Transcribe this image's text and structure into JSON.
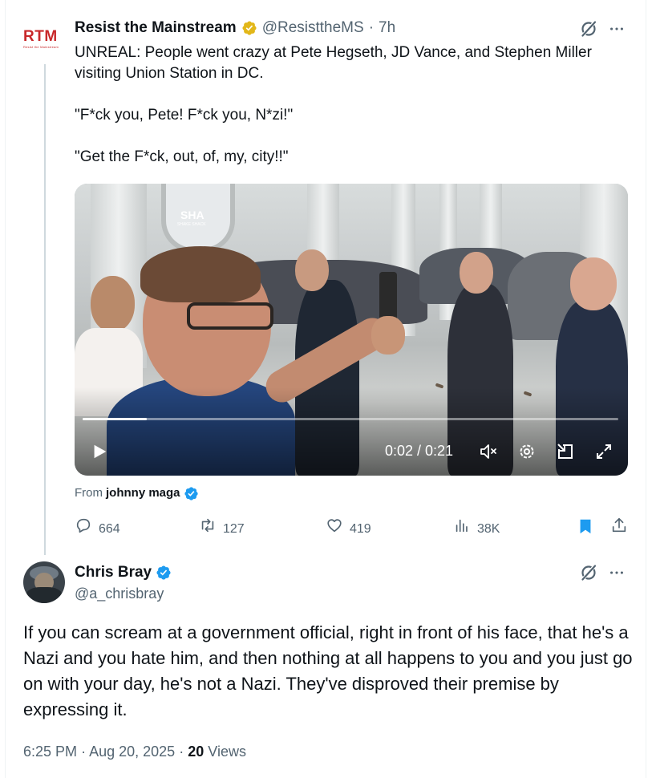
{
  "quoted_tweet": {
    "avatar_text": "RTM",
    "avatar_subtext": "Resist the Mainstream",
    "name": "Resist the Mainstream",
    "handle": "@ResisttheMS",
    "separator": "·",
    "time": "7h",
    "paragraphs": [
      "UNREAL: People went crazy at Pete Hegseth, JD Vance, and Stephen Miller visiting Union Station in DC.",
      "\"F*ck you, Pete! F*ck you, N*zi!\"",
      "\"Get the F*ck, out, of, my, city!!\""
    ],
    "video": {
      "sign_text": "SHA",
      "sign_subtext": "SHAKE SHACK",
      "timecode": "0:02 / 0:21",
      "progress": 0.12
    },
    "attribution_prefix": "From",
    "attribution_name": "johnny maga",
    "actions": {
      "replies": "664",
      "reposts": "127",
      "likes": "419",
      "views": "38K"
    }
  },
  "main_tweet": {
    "name": "Chris Bray",
    "handle": "@a_chrisbray",
    "text": "If you can scream at a government official, right in front of his face, that he's a Nazi and you hate him, and then nothing at all happens to you and you just go on with your day, he's not a Nazi. They've disproved their premise by expressing it.",
    "time": "6:25 PM",
    "date": "Aug 20, 2025",
    "dot": "·",
    "views_count": "20",
    "views_label": "Views"
  },
  "icons": {
    "verified_gold": "verified-gold-icon",
    "verified_blue": "verified-blue-icon",
    "grok": "grok-icon",
    "more": "more-icon",
    "reply": "reply-icon",
    "repost": "repost-icon",
    "like": "like-icon",
    "views": "views-icon",
    "bookmark": "bookmark-icon",
    "share": "share-icon"
  },
  "colors": {
    "text": "#0f1419",
    "secondary": "#536471",
    "accent_blue": "#1d9bf0",
    "gold": "#e2b719",
    "rtm_red": "#c8282a"
  }
}
